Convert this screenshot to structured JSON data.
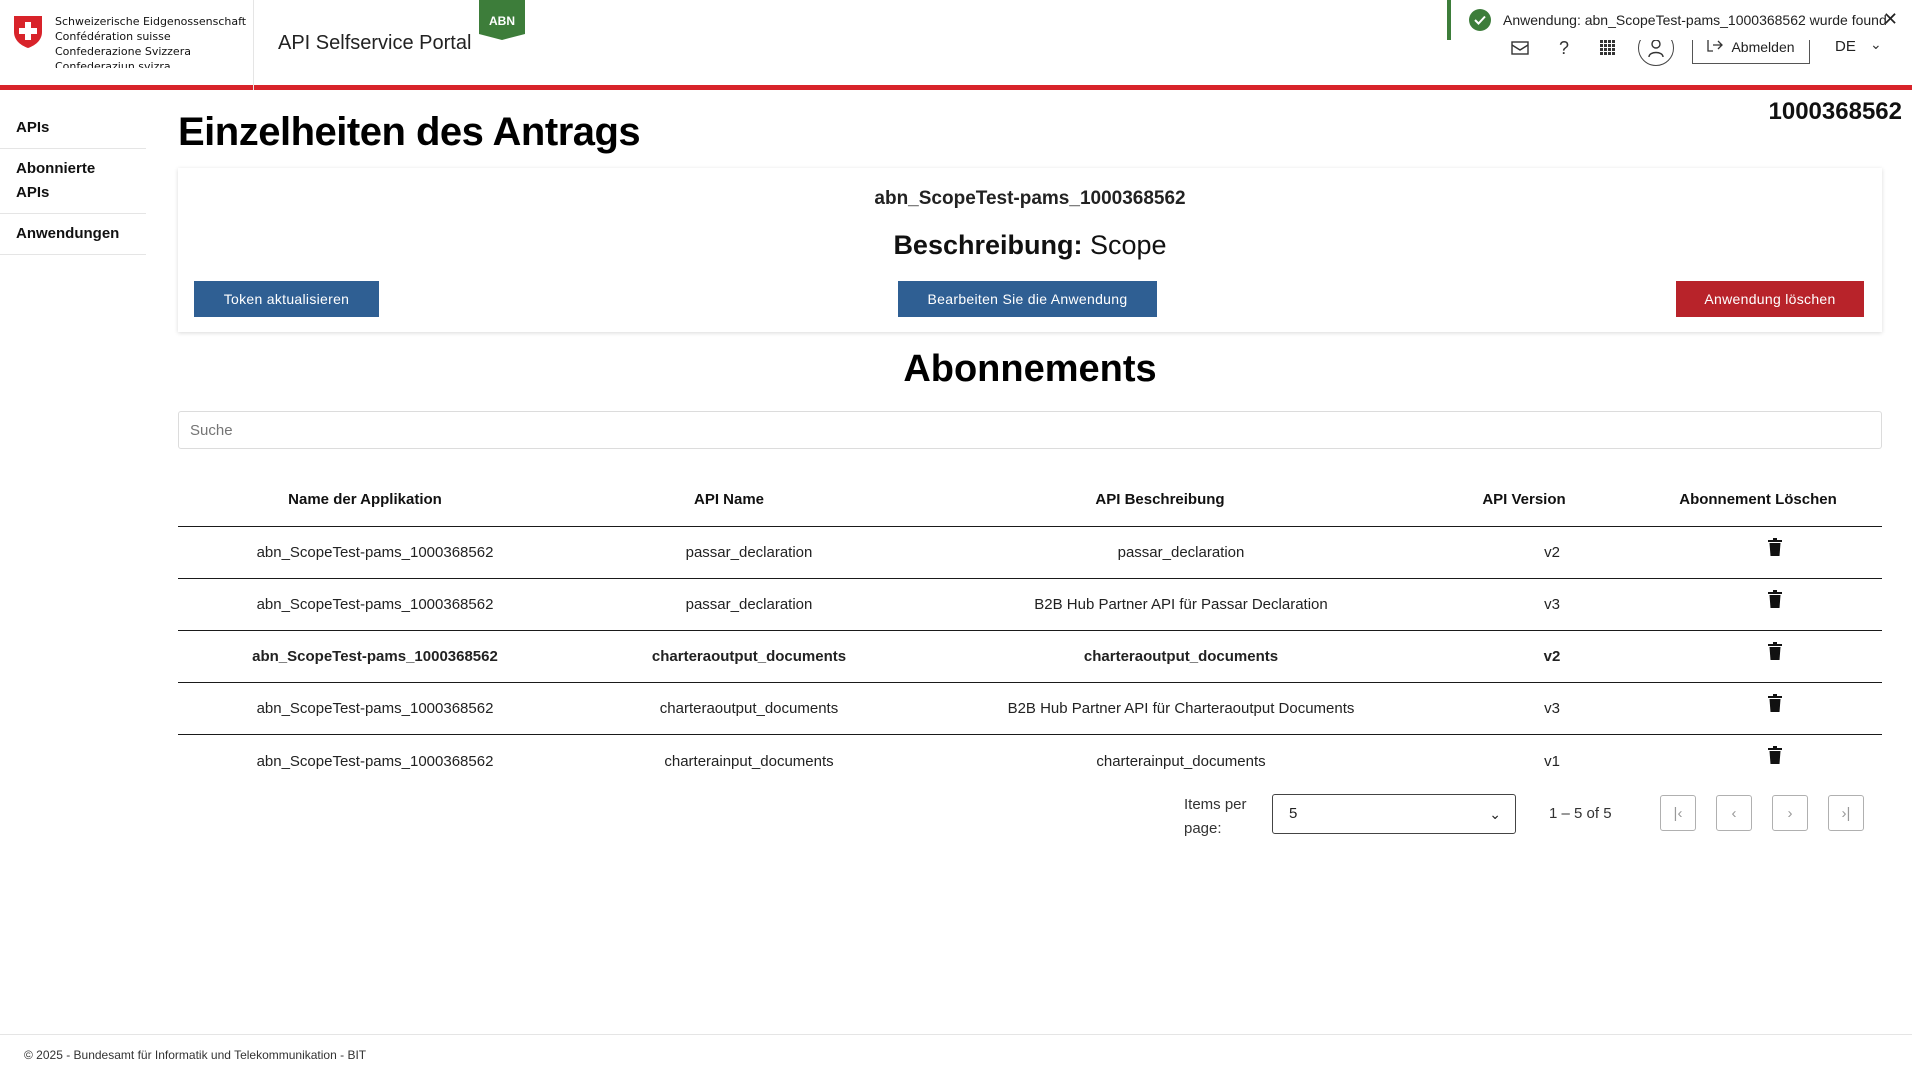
{
  "header": {
    "confederation_lines": [
      "Schweizerische Eidgenossenschaft",
      "Confédération suisse",
      "Confederazione Svizzera",
      "Confederaziun svizra"
    ],
    "portal_title": "API Selfservice Portal",
    "env_badge": "ABN",
    "toast_message": "Anwendung: abn_ScopeTest-pams_1000368562 wurde found",
    "logout_label": "Abmelden",
    "language": "DE",
    "icons": [
      "mail-icon",
      "help-icon",
      "apps-grid-icon",
      "user-icon",
      "logout-icon",
      "chevron-down-icon"
    ]
  },
  "sidebar": {
    "items": [
      {
        "label": "APIs"
      },
      {
        "label": "Abonnierte APIs"
      },
      {
        "label": "Anwendungen"
      }
    ]
  },
  "page": {
    "app_id": "1000368562",
    "title": "Einzelheiten des Antrags"
  },
  "card": {
    "app_name": "abn_ScopeTest-pams_1000368562",
    "desc_label": "Beschreibung:",
    "desc_value": "Scope",
    "btn_token": "Token aktualisieren",
    "btn_edit": "Bearbeiten Sie die Anwendung",
    "btn_delete": "Anwendung löschen"
  },
  "subscriptions": {
    "title": "Abonnements",
    "search_placeholder": "Suche",
    "columns": [
      "Name der Applikation",
      "API Name",
      "API Beschreibung",
      "API Version",
      "Abonnement Löschen"
    ],
    "rows": [
      {
        "app": "abn_ScopeTest-pams_1000368562",
        "api": "passar_declaration",
        "desc": "passar_declaration",
        "version": "v2"
      },
      {
        "app": "abn_ScopeTest-pams_1000368562",
        "api": "passar_declaration",
        "desc": "B2B Hub Partner API für Passar Declaration",
        "version": "v3"
      },
      {
        "app": "abn_ScopeTest-pams_1000368562",
        "api": "charteraoutput_documents",
        "desc": "charteraoutput_documents",
        "version": "v2"
      },
      {
        "app": "abn_ScopeTest-pams_1000368562",
        "api": "charteraoutput_documents",
        "desc": "B2B Hub Partner API für Charteraoutput Documents",
        "version": "v3"
      },
      {
        "app": "abn_ScopeTest-pams_1000368562",
        "api": "charterainput_documents",
        "desc": "charterainput_documents",
        "version": "v1"
      }
    ]
  },
  "paginator": {
    "items_per_page_label": "Items per page:",
    "page_size": "5",
    "range": "1 – 5 of 5"
  },
  "footer": {
    "text": "© 2025 - Bundesamt für Informatik und Telekommunikation - BIT"
  },
  "colors": {
    "accent_red": "#d8232a",
    "primary_blue": "#2f5f93",
    "danger_red": "#b8232a",
    "success_green": "#3d7d3a"
  }
}
